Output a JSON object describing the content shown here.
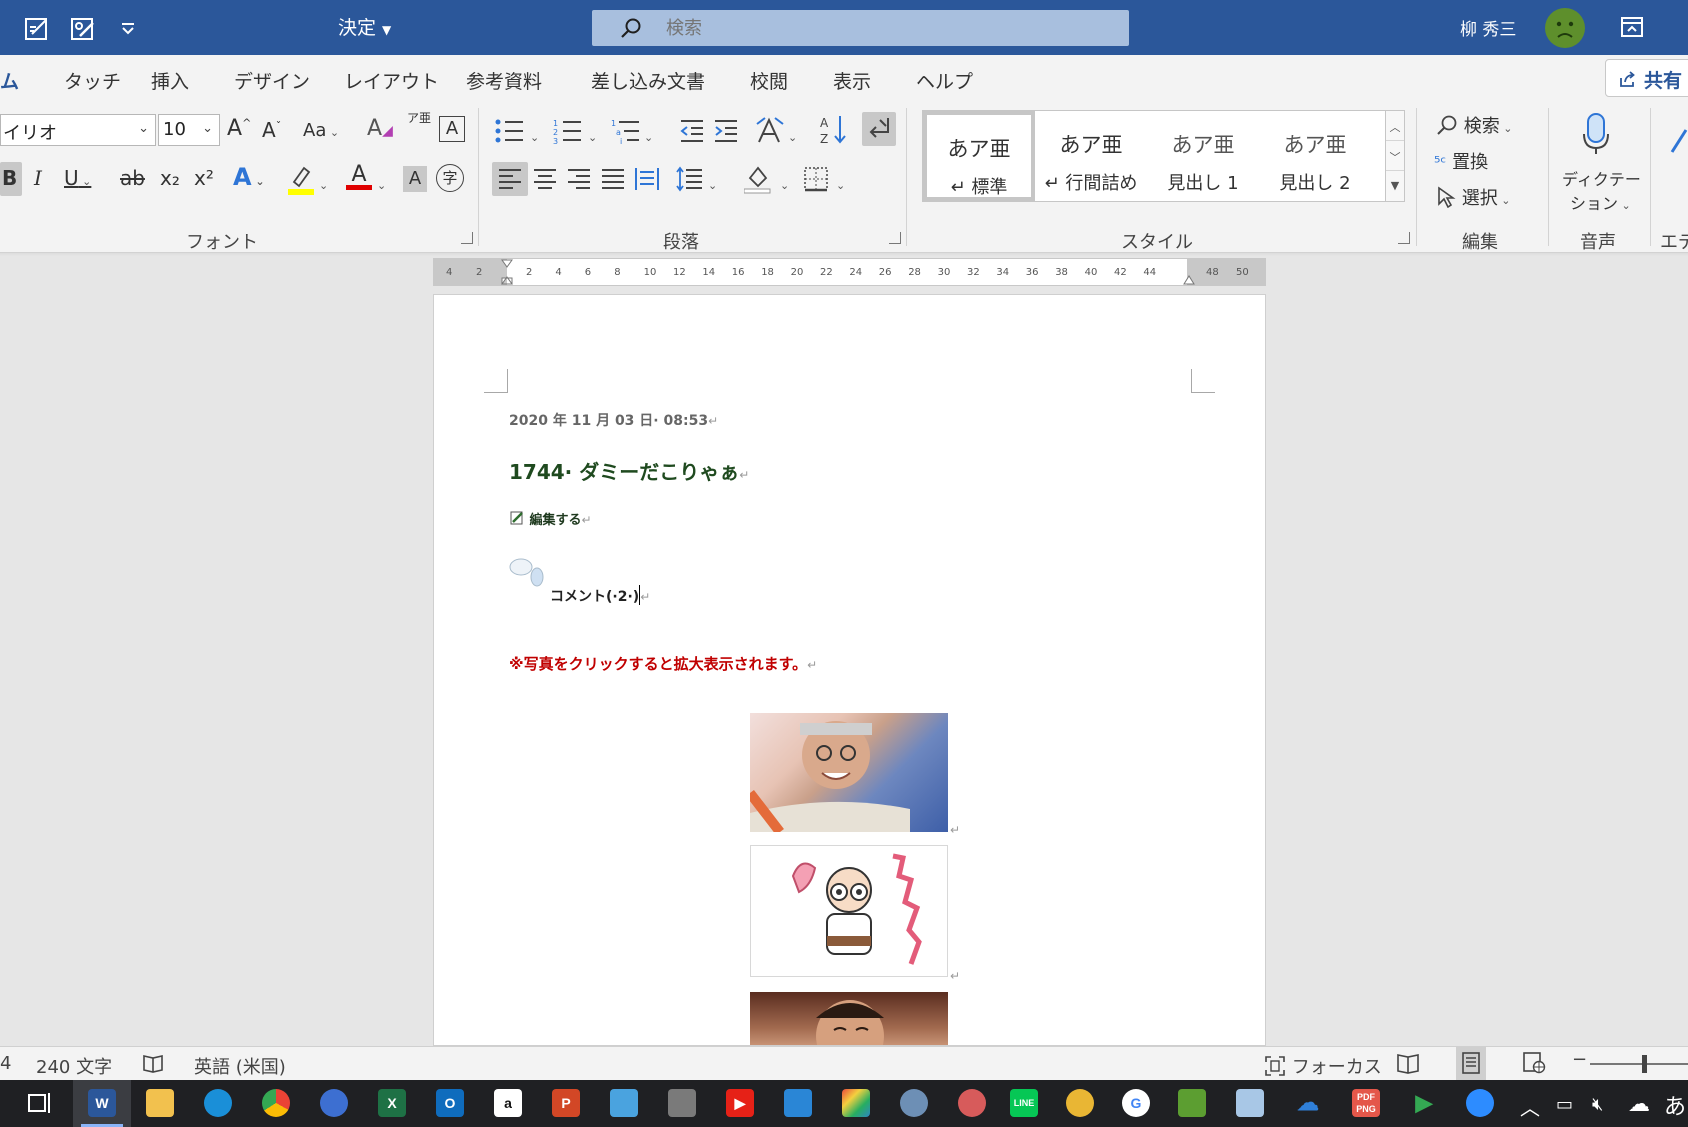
{
  "titlebar": {
    "decision_label": "決定",
    "search_placeholder": "検索",
    "user_name": "柳 秀三"
  },
  "tabs": [
    {
      "label": "ム",
      "active": true
    },
    {
      "label": "タッチ"
    },
    {
      "label": "挿入"
    },
    {
      "label": "デザイン"
    },
    {
      "label": "レイアウト"
    },
    {
      "label": "参考資料"
    },
    {
      "label": "差し込み文書"
    },
    {
      "label": "校閲"
    },
    {
      "label": "表示"
    },
    {
      "label": "ヘルプ"
    }
  ],
  "share_label": "共有",
  "font_group": {
    "font_name": "イリオ",
    "font_size": "10",
    "grow_label": "A",
    "shrink_label": "A",
    "case_label": "Aa",
    "phonetic_label": "ア亜",
    "border_label": "A",
    "bold_label": "B",
    "italic_label": "I",
    "underline_label": "U",
    "strike_label": "ab",
    "subscript_label": "x₂",
    "superscript_label": "x²",
    "effects_label": "A",
    "font_color_label": "A",
    "shading_label": "A",
    "enclose_label": "字",
    "group_label": "フォント"
  },
  "paragraph_group": {
    "group_label": "段落"
  },
  "styles_group": {
    "items": [
      {
        "preview": "あア亜",
        "name": "↵ 標準",
        "selected": true
      },
      {
        "preview": "あア亜",
        "name": "↵ 行間詰め"
      },
      {
        "preview": "あア亜",
        "name": "見出し 1"
      },
      {
        "preview": "あア亜",
        "name": "見出し 2"
      }
    ],
    "group_label": "スタイル"
  },
  "editing_group": {
    "find_label": "検索",
    "replace_label": "置換",
    "select_label": "選択",
    "group_label": "編集"
  },
  "voice_group": {
    "dictate_label_1": "ディクテー",
    "dictate_label_2": "ション",
    "group_label": "音声"
  },
  "editor_group": {
    "label": "エデ"
  },
  "ruler": {
    "left_numbers": [
      "4",
      "2"
    ],
    "numbers": [
      "2",
      "4",
      "6",
      "8",
      "10",
      "12",
      "14",
      "16",
      "18",
      "20",
      "22",
      "24",
      "26",
      "28",
      "30",
      "32",
      "34",
      "36",
      "38",
      "40",
      "42",
      "44"
    ],
    "right_numbers": [
      "48",
      "50"
    ]
  },
  "document": {
    "date": "2020 年 11 月 03 日· 08:53",
    "title": "1744· ダミーだこりゃぁ",
    "edit_link": "編集する",
    "comment": "コメント(·2·)",
    "notice": "※写真をクリックすると拡大表示されます。",
    "paragraph_mark": "↵"
  },
  "statusbar": {
    "page_fragment": "4",
    "word_count": "240 文字",
    "language": "英語 (米国)",
    "focus_label": "フォーカス"
  },
  "taskbar": {
    "ime_label": "あ"
  },
  "colors": {
    "titlebar": "#2b579a",
    "ribbon": "#f3f3f3",
    "title_green": "#1f4a1f",
    "notice_red": "#c00000",
    "taskbar": "#1f2023"
  }
}
